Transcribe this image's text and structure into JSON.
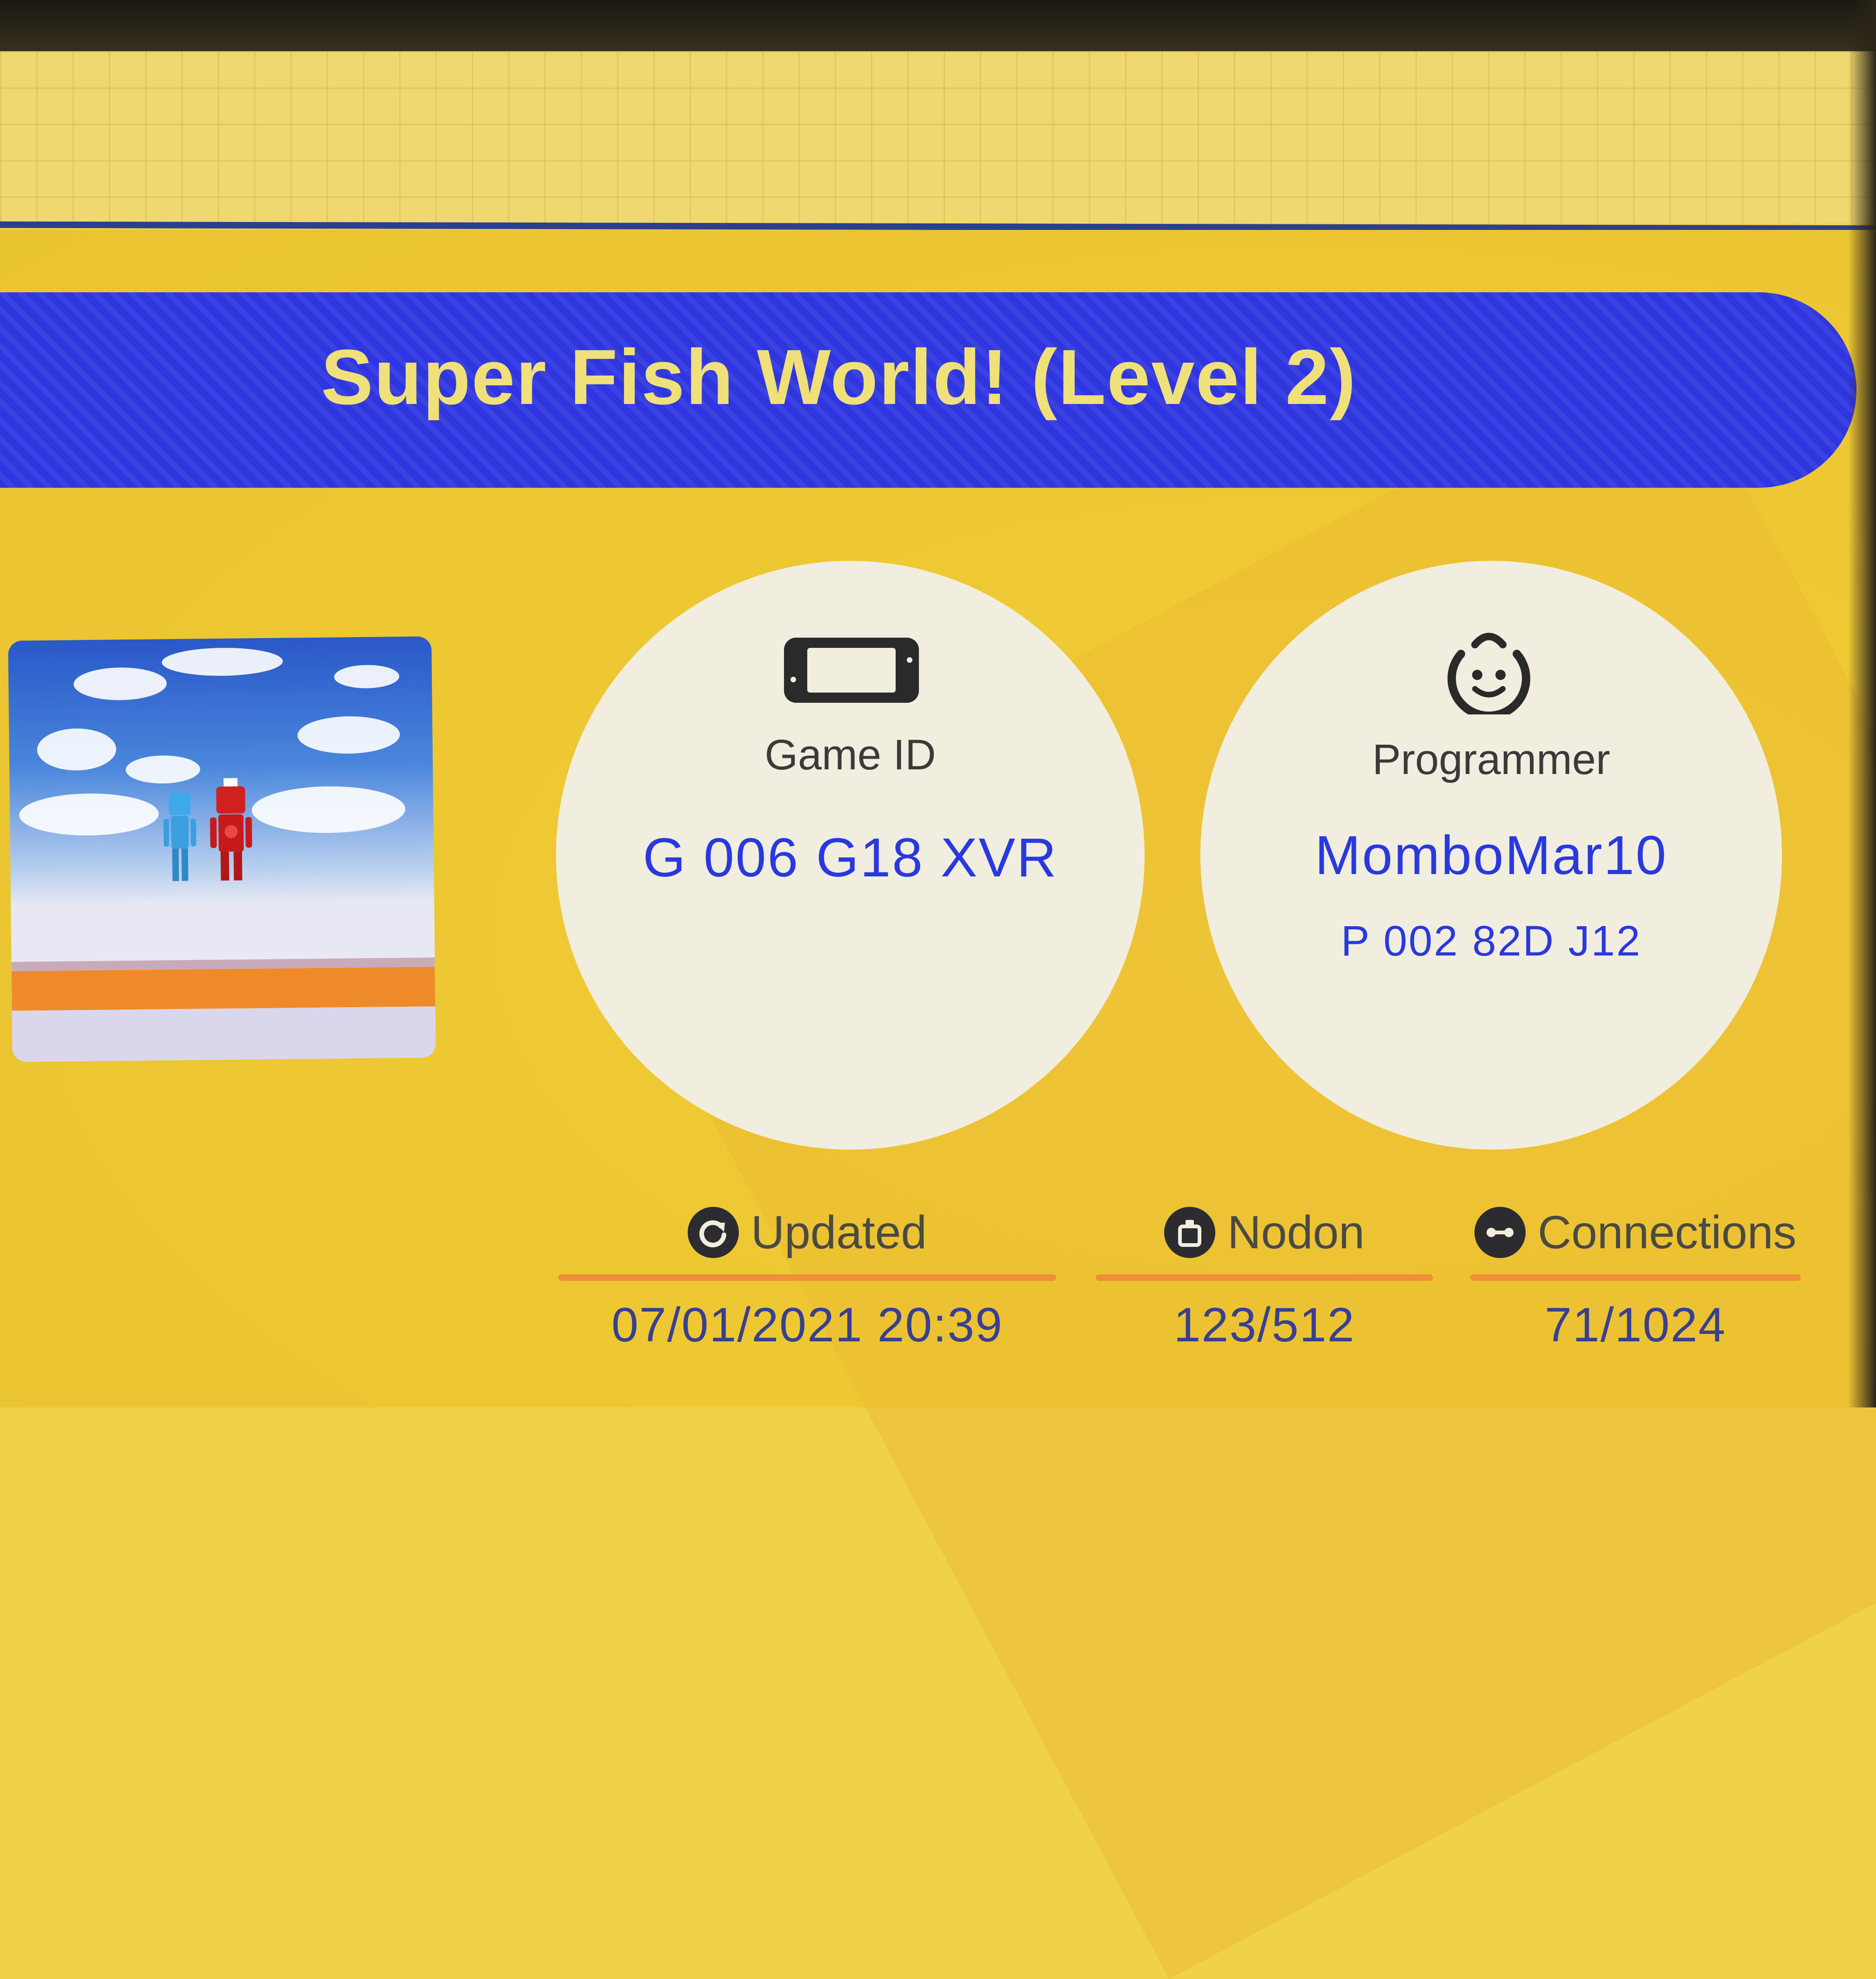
{
  "colors": {
    "background": "#f0d24a",
    "banner": "#2f36e0",
    "title_text": "#efe07a",
    "value_blue": "#2a38e0",
    "circle_fill": "#f1eedf",
    "accent_orange": "#ef8f3a"
  },
  "title": "Super Fish World! (Level 2)",
  "thumbnail": {
    "icon": "game-screenshot-thumbnail"
  },
  "game_id": {
    "icon": "console-icon",
    "label": "Game ID",
    "value": "G 006 G18 XVR"
  },
  "programmer": {
    "icon": "face-icon",
    "label": "Programmer",
    "name": "MomboMar10",
    "id": "P 002 82D J12"
  },
  "stats": {
    "updated": {
      "icon": "refresh-icon",
      "label": "Updated",
      "value": "07/01/2021 20:39"
    },
    "nodon": {
      "icon": "nodon-icon",
      "label": "Nodon",
      "value": "123/512"
    },
    "connections": {
      "icon": "connection-icon",
      "label": "Connections",
      "value": "71/1024"
    }
  }
}
